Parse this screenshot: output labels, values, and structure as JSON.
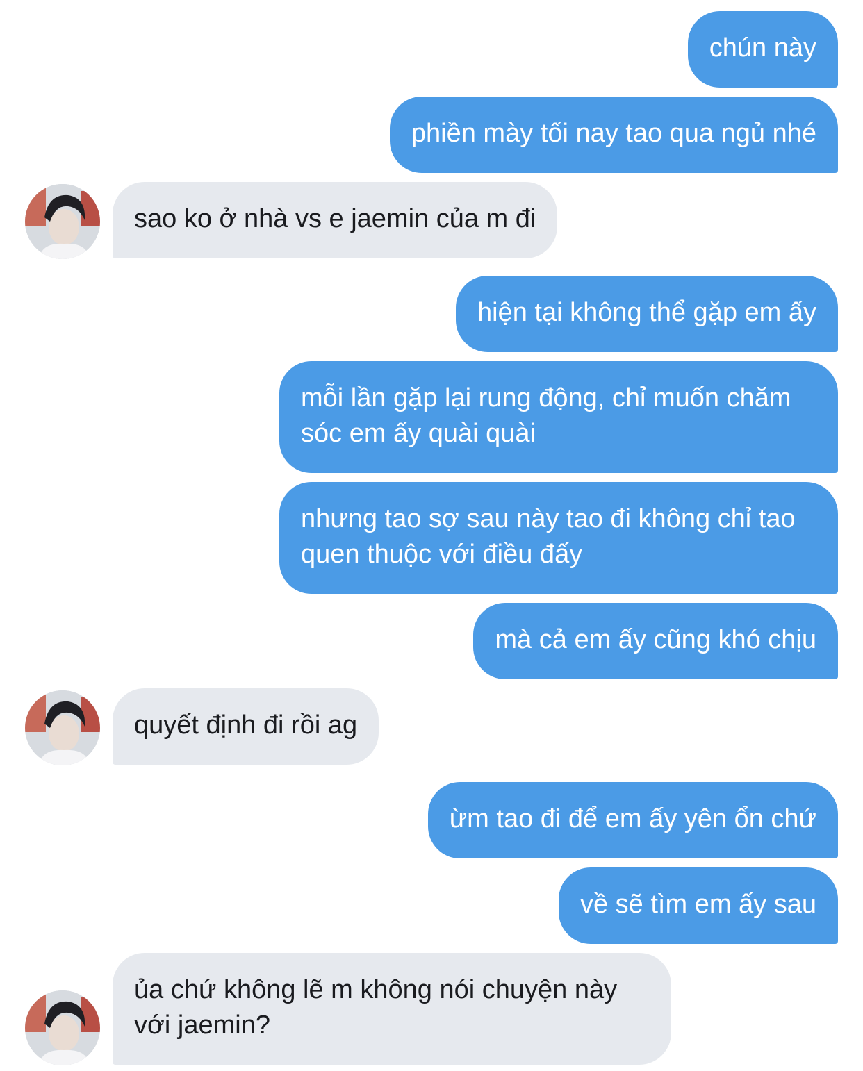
{
  "conversation": {
    "messages": [
      {
        "direction": "outgoing",
        "text": "chún này"
      },
      {
        "direction": "outgoing",
        "text": "phiền mày tối nay tao qua ngủ nhé"
      },
      {
        "direction": "incoming",
        "text": "sao ko ở nhà vs e jaemin của m đi"
      },
      {
        "direction": "outgoing",
        "text": "hiện tại không thể gặp em ấy"
      },
      {
        "direction": "outgoing",
        "text": "mỗi lần gặp lại rung động, chỉ muốn chăm sóc em ấy quài quài"
      },
      {
        "direction": "outgoing",
        "text": "nhưng tao sợ sau này tao đi không chỉ tao quen thuộc với điều đấy"
      },
      {
        "direction": "outgoing",
        "text": "mà cả em ấy cũng khó chịu"
      },
      {
        "direction": "incoming",
        "text": "quyết định đi rồi ag"
      },
      {
        "direction": "outgoing",
        "text": "ừm tao đi để em ấy yên ổn chứ"
      },
      {
        "direction": "outgoing",
        "text": "về sẽ tìm em ấy sau"
      },
      {
        "direction": "incoming",
        "text": "ủa chứ không lẽ m không nói chuyện này với jaemin?"
      }
    ]
  },
  "contact": {
    "avatar_icon": "contact-avatar-photo"
  },
  "colors": {
    "outgoing_bubble": "#4b9be6",
    "incoming_bubble": "#e6e9ee",
    "outgoing_text": "#ffffff",
    "incoming_text": "#1a1b1f",
    "background": "#ffffff"
  }
}
